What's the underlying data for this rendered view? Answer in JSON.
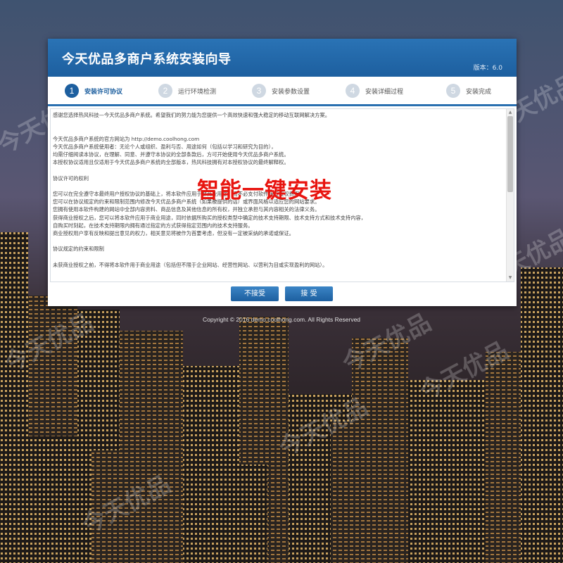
{
  "installer": {
    "title": "今天优品多商户系统安装向导",
    "version": "版本：6.0"
  },
  "steps": [
    {
      "number": "1",
      "label": "安装许可协议"
    },
    {
      "number": "2",
      "label": "运行环境检测"
    },
    {
      "number": "3",
      "label": "安装参数设置"
    },
    {
      "number": "4",
      "label": "安装详细过程"
    },
    {
      "number": "5",
      "label": "安装完成"
    }
  ],
  "license": {
    "lines": [
      "感谢您选择热风科技—今天优品多商户系统。希望我们的努力能为您提供一个高效快速和强大稳定的移动互联网解决方案。",
      "",
      "",
      "今天优品多商户系统的官方网站为 http://demo.coolhong.com",
      "今天优品多商户系统使用者：无论个人或组织、盈利与否、用途如何（包括以学习和研究为目的），",
      "均需仔细阅读本协议，在理解、同意、并遵守本协议的全部条款后，方可开始使用今天优品多商户系统。",
      "本授权协议适用且仅适用于今天优品多商户系统的全部版本，热风科技拥有对本授权协议的最终解释权。",
      "",
      "协议许可的权利",
      "",
      "您可以在完全遵守本最终用户授权协议的基础上，将本软件应用于非商业用途，而不必支付软件版权授权费用。",
      "您可以在协议规定的约束和限制范围内修改今天优品多商户系统（如果被提供的话）或界面风格以适应您的网站要求。",
      "您拥有使用本软件构建的网站中全部内容资料、商品信息及其他信息的所有权，并独立承担与其内容相关的法律义务。",
      "获得商业授权之后，您可以将本软件应用于商业用途，同时依据所购买的授权类型中确定的技术支持期限、技术支持方式和技术支持内容，",
      "自购买时刻起，在技术支持期限内拥有通过指定的方式获得指定范围内的技术支持服务。",
      "商业授权用户享有反映和提出意见的权力，相关意见将被作为首要考虑，但没有一定被采纳的承诺或保证。",
      "",
      "协议规定的约束和限制",
      "",
      "未获商业授权之前，不得将本软件用于商业用途（包括但不限于企业网站、经营性网站、以营利为目或实现盈利的网站）。"
    ]
  },
  "promo_text": "智能一键安装",
  "buttons": {
    "reject": "不接受",
    "accept": "接 受"
  },
  "copyright": "Copyright © 2016 demo.coolhong.com. All Rights Reserved",
  "watermark": "今天优品",
  "colors": {
    "header_blue": "#1d5f9f",
    "step_inactive": "#cfd8e2",
    "promo_red": "#e8140f"
  }
}
